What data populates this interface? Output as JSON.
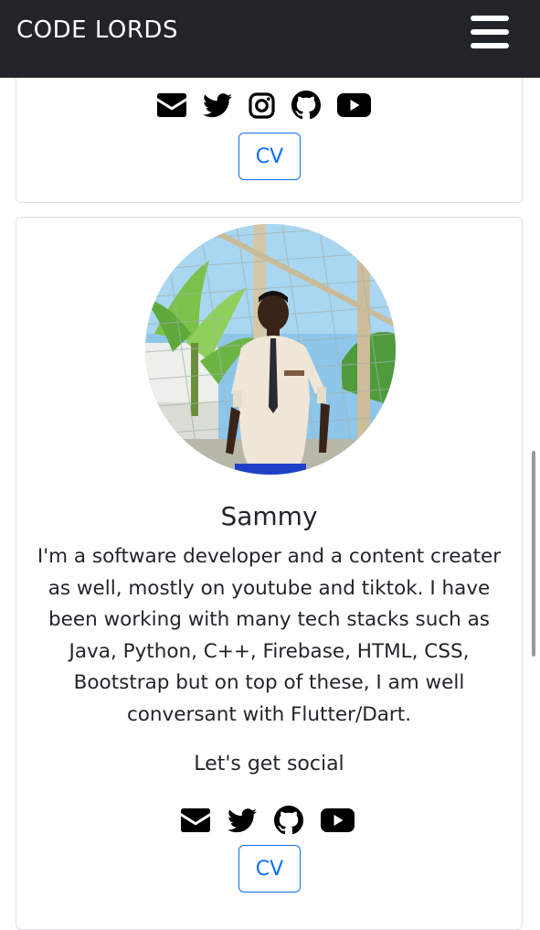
{
  "navbar": {
    "brand": "CODE LORDS",
    "menu_icon": "hamburger-menu-icon"
  },
  "card_previous": {
    "social_icons": [
      "envelope-icon",
      "twitter-icon",
      "instagram-icon",
      "github-icon",
      "youtube-icon"
    ],
    "cv_label": "CV"
  },
  "card_sammy": {
    "name": "Sammy",
    "bio": "I'm a software developer and a content creater as well, mostly on youtube and tiktok. I have been working with many tech stacks such as Java, Python, C++, Firebase, HTML, CSS, Bootstrap but on top of these, I am well conversant with Flutter/Dart.",
    "social_heading": "Let's get social",
    "social_icons": [
      "envelope-icon",
      "twitter-icon",
      "github-icon",
      "youtube-icon"
    ],
    "cv_label": "CV"
  },
  "colors": {
    "navbar_bg": "#212529",
    "accent": "#0d6efd",
    "card_border": "#dfe1e5"
  }
}
